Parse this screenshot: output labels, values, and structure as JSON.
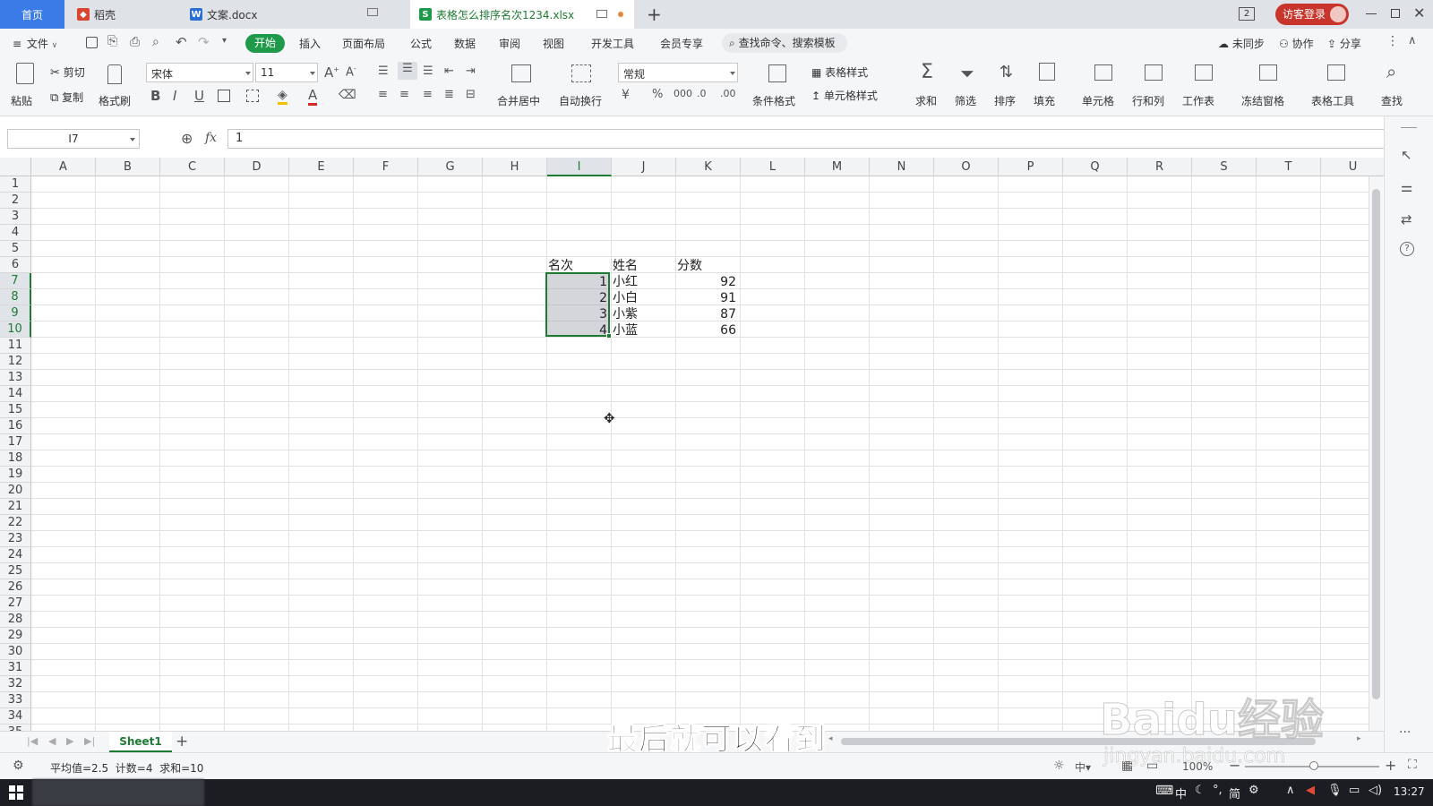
{
  "tabs": {
    "home": "首页",
    "daoke": "稻壳",
    "doc": "文案.docx",
    "xlsx": "表格怎么排序名次1234.xlsx",
    "login": "访客登录"
  },
  "menu": {
    "file": "文件",
    "items": [
      "开始",
      "插入",
      "页面布局",
      "公式",
      "数据",
      "审阅",
      "视图",
      "开发工具",
      "会员专享"
    ],
    "search": "查找命令、搜索模板",
    "sync": "未同步",
    "collab": "协作",
    "share": "分享"
  },
  "ribbon": {
    "paste": "粘贴",
    "cut": "剪切",
    "copy": "复制",
    "format_painter": "格式刷",
    "font_name": "宋体",
    "font_size": "11",
    "merge": "合并居中",
    "wrap": "自动换行",
    "number_format": "常规",
    "cond_format": "条件格式",
    "table_style": "表格样式",
    "cell_style": "单元格样式",
    "sum": "求和",
    "filter": "筛选",
    "sort": "排序",
    "fill": "填充",
    "cells": "单元格",
    "rows_cols": "行和列",
    "worksheet": "工作表",
    "freeze": "冻结窗格",
    "table_tools": "表格工具",
    "find": "查找"
  },
  "formula_bar": {
    "name_box": "I7",
    "fx": "fx",
    "value": "1"
  },
  "grid": {
    "columns": [
      "A",
      "B",
      "C",
      "D",
      "E",
      "F",
      "G",
      "H",
      "I",
      "J",
      "K",
      "L",
      "M",
      "N",
      "O",
      "P",
      "Q",
      "R",
      "S",
      "T",
      "U"
    ],
    "selected_column": "I",
    "selected_rows": [
      7,
      8,
      9,
      10
    ],
    "headers": [
      "名次",
      "姓名",
      "分数"
    ],
    "rows": [
      {
        "rank": "1",
        "name": "小红",
        "score": "92"
      },
      {
        "rank": "2",
        "name": "小白",
        "score": "91"
      },
      {
        "rank": "3",
        "name": "小紫",
        "score": "87"
      },
      {
        "rank": "4",
        "name": "小蓝",
        "score": "66"
      }
    ]
  },
  "sheets": {
    "active": "Sheet1"
  },
  "status": {
    "stats": "平均值=2.5  计数=4  求和=10",
    "zoom": "100%"
  },
  "subtitle": "最后就可以看到",
  "watermark": {
    "logo": "Baidu经验",
    "url": "jingyan.baidu.com"
  },
  "taskbar": {
    "time": "13:27",
    "ime": "中",
    "lang": "简"
  },
  "colors": {
    "accent": "#1e7b34",
    "brand_red": "#c7352c"
  }
}
